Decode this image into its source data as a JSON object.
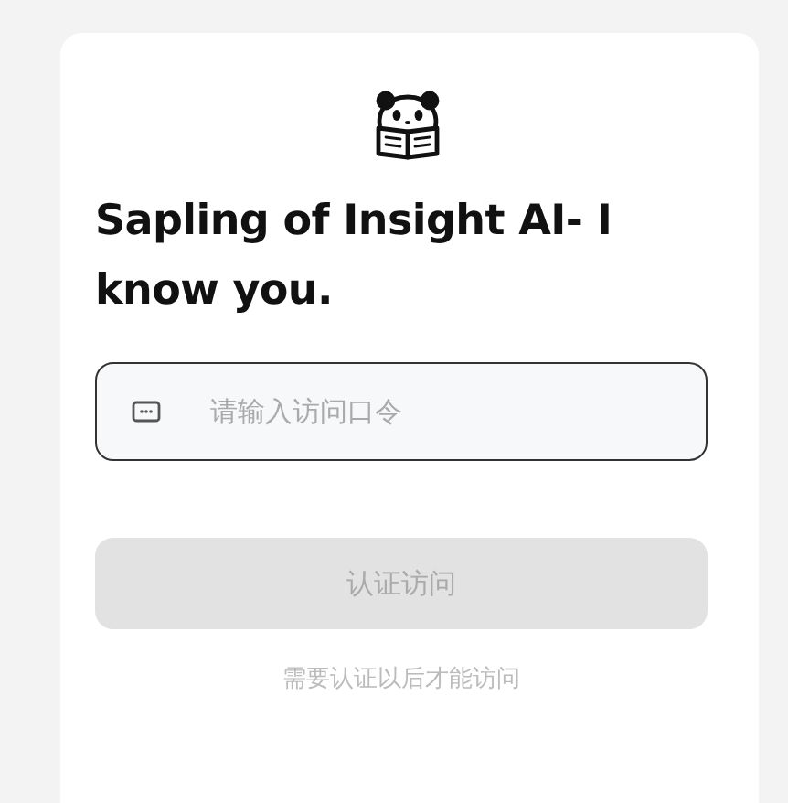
{
  "title": "Sapling of Insight AI- I know you.",
  "password_field": {
    "placeholder": "请输入访问口令"
  },
  "submit_button": {
    "label": "认证访问",
    "disabled": true
  },
  "hint": "需要认证以后才能访问"
}
